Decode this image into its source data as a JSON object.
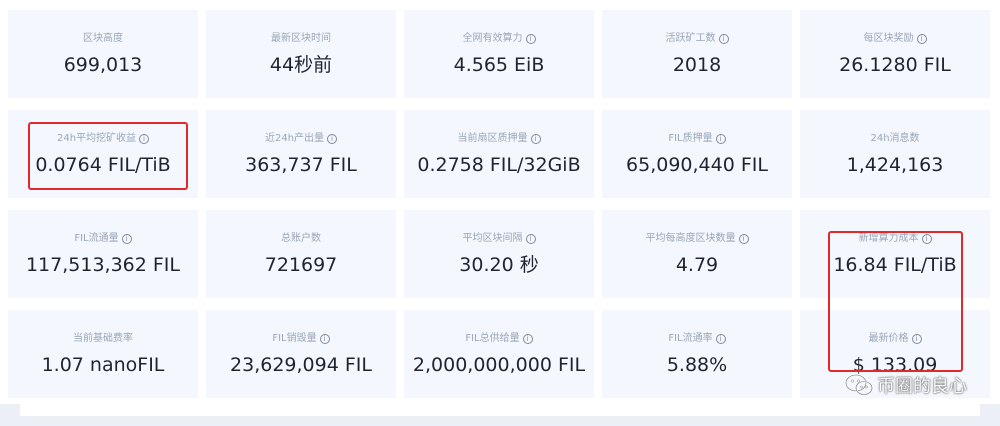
{
  "stats": [
    {
      "label": "区块高度",
      "info": false,
      "value": "699,013"
    },
    {
      "label": "最新区块时间",
      "info": false,
      "value": "44秒前"
    },
    {
      "label": "全网有效算力",
      "info": true,
      "value": "4.565 EiB"
    },
    {
      "label": "活跃矿工数",
      "info": true,
      "value": "2018"
    },
    {
      "label": "每区块奖励",
      "info": true,
      "value": "26.1280 FIL"
    },
    {
      "label": "24h平均挖矿收益",
      "info": true,
      "value": "0.0764 FIL/TiB"
    },
    {
      "label": "近24h产出量",
      "info": true,
      "value": "363,737 FIL"
    },
    {
      "label": "当前扇区质押量",
      "info": true,
      "value": "0.2758 FIL/32GiB"
    },
    {
      "label": "FIL质押量",
      "info": true,
      "value": "65,090,440 FIL"
    },
    {
      "label": "24h消息数",
      "info": false,
      "value": "1,424,163"
    },
    {
      "label": "FIL流通量",
      "info": true,
      "value": "117,513,362 FIL"
    },
    {
      "label": "总账户数",
      "info": false,
      "value": "721697"
    },
    {
      "label": "平均区块间隔",
      "info": true,
      "value": "30.20 秒"
    },
    {
      "label": "平均每高度区块数量",
      "info": true,
      "value": "4.79"
    },
    {
      "label": "新增算力成本",
      "info": true,
      "value": "16.84 FIL/TiB"
    },
    {
      "label": "当前基础费率",
      "info": false,
      "value": "1.07 nanoFIL"
    },
    {
      "label": "FIL销毁量",
      "info": true,
      "value": "23,629,094 FIL"
    },
    {
      "label": "FIL总供给量",
      "info": true,
      "value": "2,000,000,000 FIL"
    },
    {
      "label": "FIL流通率",
      "info": true,
      "value": "5.88%"
    },
    {
      "label": "最新价格",
      "info": true,
      "value": "$ 133.09"
    }
  ],
  "info_icon_glyph": "i",
  "watermark": {
    "text": "币圈的良心",
    "icon": "wechat-icon"
  },
  "colors": {
    "highlight": "#e02a2a",
    "card_bg": "#f4f7fd"
  }
}
